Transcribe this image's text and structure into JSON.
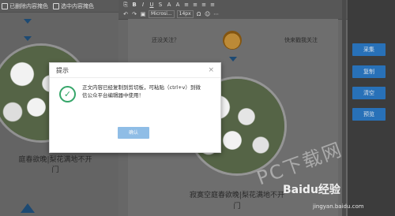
{
  "left_panel": {
    "checkbox1_label": "已删除内容掩色",
    "checkbox2_label": "选中内容掩色",
    "poem_line1": "庭春欲晚|梨花满地不开",
    "poem_line2": "门"
  },
  "editor": {
    "toolbar": {
      "buttons": [
        "⎘",
        "B",
        "I",
        "U",
        "S",
        "A",
        "A",
        "≡",
        "≡",
        "≡",
        "≡",
        "≡"
      ],
      "font_select": "Microsi...",
      "size_select": "14px",
      "row2": [
        "↶",
        "↷",
        "▣",
        "Ω",
        "☺",
        "⋯",
        "⋯",
        "⋯"
      ]
    },
    "banner_left": "还没关注？",
    "banner_right": "快来戳我关注",
    "poem_line1": "寂寞空庭春欲晚|梨花满地不开",
    "poem_line2": "门"
  },
  "right_panel": {
    "buttons": [
      "采集",
      "复制",
      "清空",
      "预览"
    ]
  },
  "dialog": {
    "title": "提示",
    "close": "×",
    "message_line1": "正文内容已经复制到剪切板，可粘贴（ctrl+v）到微",
    "message_line2": "信公众平台编辑器中使用！",
    "ok_label": "确认"
  },
  "watermark": {
    "pc_download": "PC下载网",
    "baidu": "Baidu经验",
    "site": "jingyan.baidu.com"
  },
  "colors": {
    "accent_blue": "#2b78c2",
    "ok_button": "#8fbde6",
    "success_green": "#36a66a",
    "icon_navy": "#1f4f7a"
  }
}
